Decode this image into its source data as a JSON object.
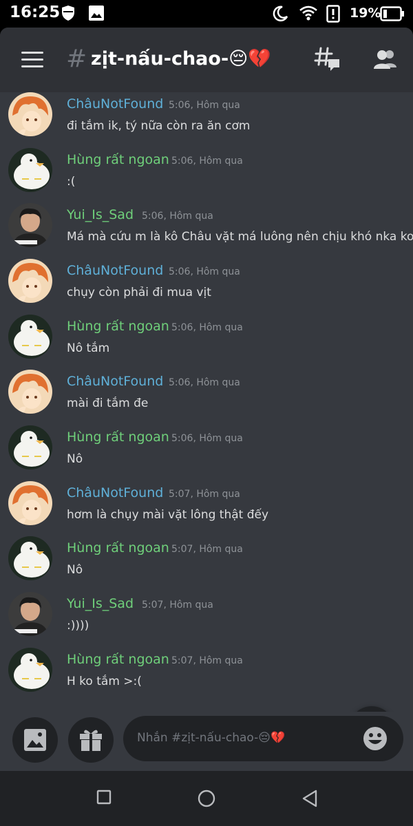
{
  "status_bar": {
    "time": "16:25",
    "battery_percent": "19%",
    "icons": [
      "shield-icon",
      "image-icon",
      "moon-icon",
      "wifi-icon",
      "alert-icon",
      "battery-icon"
    ]
  },
  "header": {
    "hash_symbol": "#",
    "channel_name": "zịt-nấu-chao-😔💔"
  },
  "colors": {
    "background": "#36393f",
    "header": "#2f3136",
    "dark": "#202225",
    "name_blue": "#5fb0d8",
    "name_green": "#6fcf7a"
  },
  "messages": [
    {
      "author": "ChâuNotFound",
      "time": "5:06, Hôm qua",
      "text": "đi tắm ik, tý nữa còn ra ăn cơm",
      "avatar": "anime-avatar"
    },
    {
      "author": "Hùng rất ngoan",
      "time": "5:06, Hôm qua",
      "text": ":(",
      "avatar": "duck-avatar"
    },
    {
      "author": "Yui_Is_Sad",
      "time": "5:06, Hôm qua",
      "text": "Má mà cứu m là kô Châu vặt má luông nên chịu khó nka kon:((",
      "avatar": "photo-avatar"
    },
    {
      "author": "ChâuNotFound",
      "time": "5:06, Hôm qua",
      "text": "chụy còn phải đi mua vịt",
      "avatar": "anime-avatar"
    },
    {
      "author": "Hùng rất ngoan",
      "time": "5:06, Hôm qua",
      "text": "Nô tắm",
      "avatar": "duck-avatar"
    },
    {
      "author": "ChâuNotFound",
      "time": "5:06, Hôm qua",
      "text": "mài đi tắm đe",
      "avatar": "anime-avatar"
    },
    {
      "author": "Hùng rất ngoan",
      "time": "5:06, Hôm qua",
      "text": "Nô",
      "avatar": "duck-avatar"
    },
    {
      "author": "ChâuNotFound",
      "time": "5:07, Hôm qua",
      "text": "hơm là chụy mài vặt lông thật đếy",
      "avatar": "anime-avatar"
    },
    {
      "author": "Hùng rất ngoan",
      "time": "5:07, Hôm qua",
      "text": "Nô",
      "avatar": "duck-avatar"
    },
    {
      "author": "Yui_Is_Sad",
      "time": "5:07, Hôm qua",
      "text": ":))))",
      "avatar": "photo-avatar"
    },
    {
      "author": "Hùng rất ngoan",
      "time": "5:07, Hôm qua",
      "text": "H ko tắm >:(",
      "avatar": "duck-avatar"
    }
  ],
  "composer": {
    "placeholder": "Nhắn #zịt-nấu-chao-😔💔",
    "buttons": [
      "image-icon",
      "gift-icon",
      "emoji-icon"
    ]
  },
  "scroll_button": "chevron-down-icon",
  "nav_bar": [
    "recents-square-icon",
    "home-circle-icon",
    "back-triangle-icon"
  ]
}
